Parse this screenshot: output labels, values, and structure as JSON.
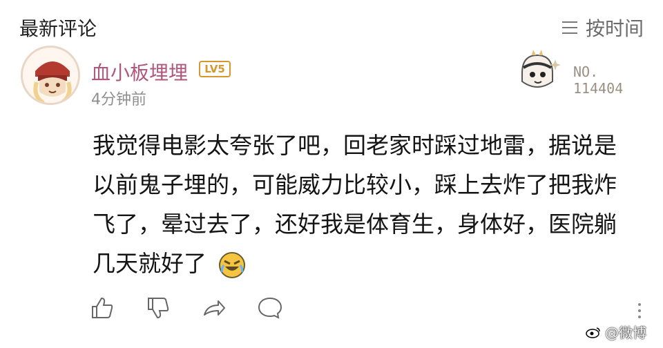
{
  "header": {
    "title": "最新评论",
    "sort_label": "按时间",
    "sort_icon": "menu-lines-icon"
  },
  "comment": {
    "username": "血小板埋埋",
    "level_badge": "LV5",
    "time": "4分钟前",
    "badge_number_prefix": "NO.",
    "badge_number": "114404",
    "text": "我觉得电影太夸张了吧，回老家时踩过地雷，据说是以前鬼子埋的，可能威力比较小，踩上去炸了把我炸飞了，晕过去了，还好我是体育生，身体好，医院躺几天就好了",
    "emoji": "laughing-emoji-icon"
  },
  "actions": [
    "like-icon",
    "dislike-icon",
    "share-icon",
    "comment-icon"
  ],
  "watermark": "@微博",
  "colors": {
    "username": "#b2567a",
    "level": "#d9962b",
    "muted": "#8f8f8f"
  }
}
